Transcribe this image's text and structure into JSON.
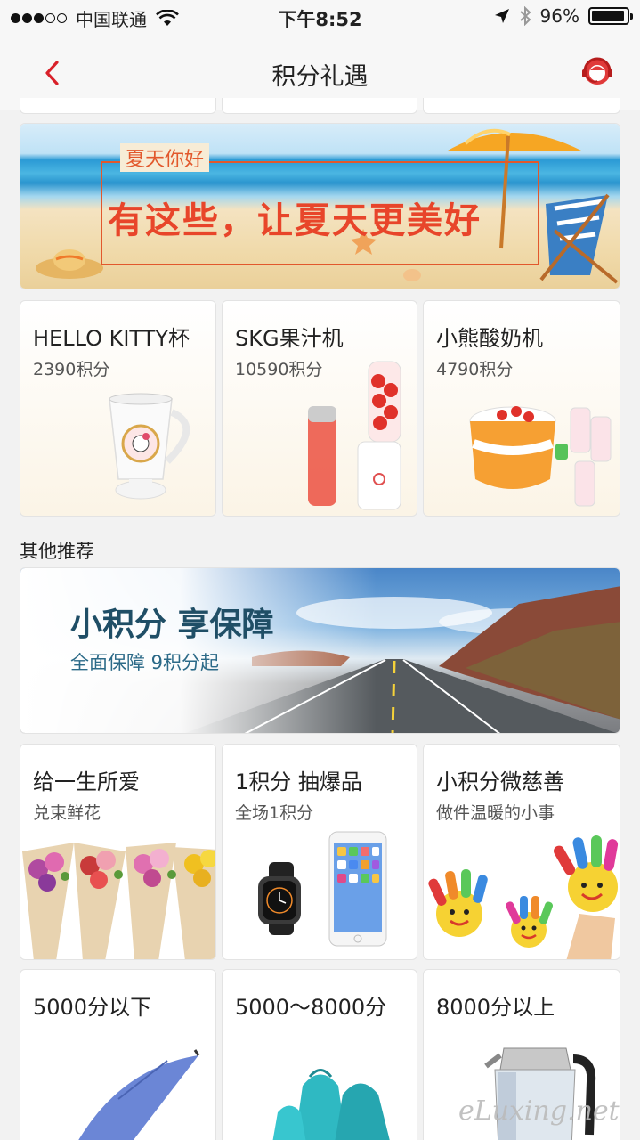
{
  "status_bar": {
    "carrier": "中国联通",
    "time": "下午8:52",
    "battery": "96%",
    "battery_level": 0.96
  },
  "nav": {
    "title": "积分礼遇",
    "back_icon": "chevron-left-icon",
    "service_icon": "customer-service-icon",
    "accent_color": "#d9212a"
  },
  "summer_banner": {
    "tag": "夏天你好",
    "headline": "有这些，让夏天更美好"
  },
  "featured_products": [
    {
      "name": "HELLO KITTY杯",
      "points": "2390积分",
      "image_icon": "mug-icon"
    },
    {
      "name": "SKG果汁机",
      "points": "10590积分",
      "image_icon": "juicer-icon"
    },
    {
      "name": "小熊酸奶机",
      "points": "4790积分",
      "image_icon": "yogurt-maker-icon"
    }
  ],
  "other_section": {
    "label": "其他推荐"
  },
  "insurance_banner": {
    "title": "小积分 享保障",
    "subtitle": "全面保障 9积分起"
  },
  "category_tiles": [
    {
      "title": "给一生所爱",
      "subtitle": "兑束鲜花",
      "image_icon": "flowers-icon"
    },
    {
      "title": "1积分 抽爆品",
      "subtitle": "全场1积分",
      "image_icon": "watch-phone-icon"
    },
    {
      "title": "小积分微慈善",
      "subtitle": "做件温暖的小事",
      "image_icon": "painted-hands-icon"
    }
  ],
  "point_ranges": [
    {
      "title": "5000分以下",
      "image_icon": "umbrella-icon"
    },
    {
      "title": "5000～8000分",
      "image_icon": "bags-icon"
    },
    {
      "title": "8000分以上",
      "image_icon": "kettle-icon"
    }
  ],
  "watermark": "eLuxing.net"
}
